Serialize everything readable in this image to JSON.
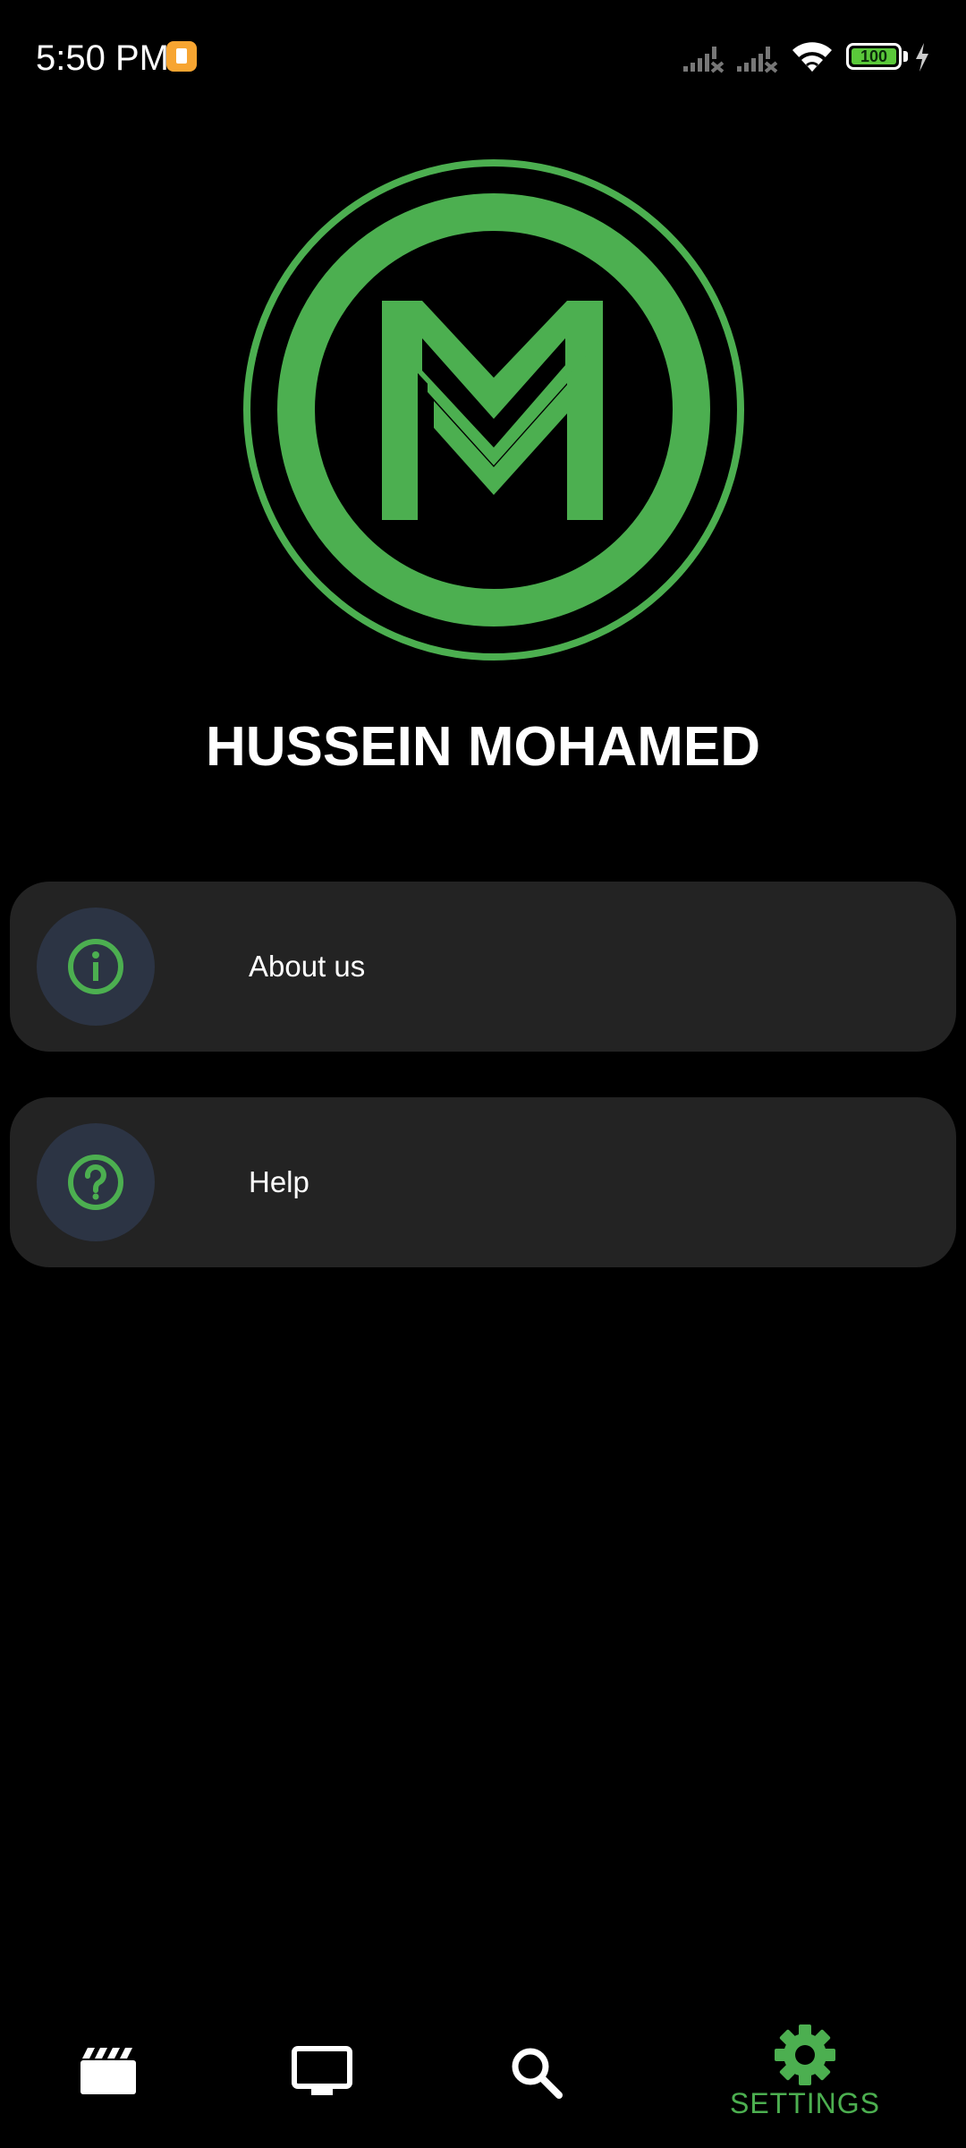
{
  "status_bar": {
    "time": "5:50 PM",
    "battery_level": "100",
    "icons": [
      "notification-icon",
      "signal-icon",
      "signal-icon",
      "wifi-icon",
      "battery-icon",
      "charging-icon"
    ]
  },
  "profile": {
    "name": "HUSSEIN MOHAMED",
    "logo_icon": "m-logo-icon"
  },
  "menu": {
    "items": [
      {
        "label": "About us",
        "icon": "info-icon"
      },
      {
        "label": "Help",
        "icon": "help-icon"
      }
    ]
  },
  "bottom_nav": {
    "items": [
      {
        "icon": "movie-clapper-icon",
        "label": ""
      },
      {
        "icon": "tv-icon",
        "label": ""
      },
      {
        "icon": "search-icon",
        "label": ""
      },
      {
        "icon": "settings-icon",
        "label": "SETTINGS",
        "active": true
      }
    ]
  },
  "colors": {
    "accent": "#4caf50",
    "background": "#000000",
    "card": "#232323",
    "icon_circle": "#2c3444"
  }
}
